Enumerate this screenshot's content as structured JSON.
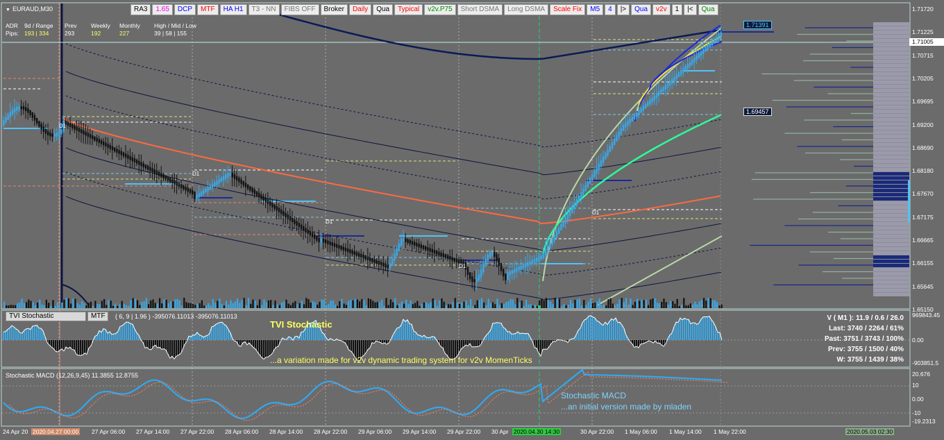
{
  "symbol": "EURAUD,M30",
  "toolbar": [
    {
      "label": "RA3",
      "color": "#000000"
    },
    {
      "label": "1.65",
      "color": "#ff00ff"
    },
    {
      "label": "DCP",
      "color": "#0000ff"
    },
    {
      "label": "MTF",
      "color": "#ff0000"
    },
    {
      "label": "HA H1",
      "color": "#0000ff"
    },
    {
      "label": "T3 - NN",
      "color": "#777777"
    },
    {
      "label": "FIBS OFF",
      "color": "#777777"
    },
    {
      "label": "Broker",
      "color": "#000000"
    },
    {
      "label": "Daily",
      "color": "#ff0000"
    },
    {
      "label": "Qua",
      "color": "#000000"
    },
    {
      "label": "Typical",
      "color": "#ff0000"
    },
    {
      "label": "v2v.P75",
      "color": "#008800"
    },
    {
      "label": "Short DSMA",
      "color": "#777777"
    },
    {
      "label": "Long DSMA",
      "color": "#777777"
    },
    {
      "label": "Scale Fix",
      "color": "#ff0000"
    },
    {
      "label": "M5",
      "color": "#0000ff"
    },
    {
      "label": "4",
      "color": "#0000ff"
    },
    {
      "label": "|>",
      "color": "#000000"
    },
    {
      "label": "Qua",
      "color": "#0000ff"
    },
    {
      "label": "v2v",
      "color": "#ff0000"
    },
    {
      "label": "1",
      "color": "#000000"
    },
    {
      "label": "|<",
      "color": "#000000"
    },
    {
      "label": "Qua",
      "color": "#008800"
    }
  ],
  "adr": {
    "h1": "ADR",
    "h2": "9d / Range",
    "h3": "Prev",
    "h4": "Weekly",
    "h5": "Monthly",
    "h6": "High / Mid / Low",
    "r1": "Pips:",
    "r2": "193 | 334",
    "r3": "293",
    "r4": "192",
    "r5": "227",
    "r6": "39 | 58 | 155"
  },
  "price_axis": [
    "1.71720",
    "1.71225",
    "1.70715",
    "1.70205",
    "1.69695",
    "1.69200",
    "1.68690",
    "1.68180",
    "1.67670",
    "1.67175",
    "1.66665",
    "1.66155",
    "1.65645",
    "1.65150"
  ],
  "current_price": "1.71005",
  "tags": {
    "upper": "1.71391",
    "lower": "1.69457"
  },
  "d1_label": "D1",
  "tvi": {
    "title": "TVI Stochastic",
    "mtf": "MTF",
    "params": "( 6, 9 | 1.96 ) -395076.11013 -395076.11013",
    "heading": "TVI Stochastic",
    "caption": "...a variation made for v2v dynamic trading system for v2v MomenTicks",
    "axis": [
      "969843.45",
      "0.00",
      "-903851.5"
    ],
    "info": [
      "V ( M1 ): 11.9 / 0.6 / 26.0",
      "Last: 3740 / 2264 / 61%",
      "Past: 3751 / 3743 / 100%",
      "Prev: 3755 / 1500 / 40%",
      "W: 3755 / 1439 / 38%"
    ]
  },
  "macd": {
    "title": "Stochastic MACD (12,26,9,45) 11.3855 12.8755",
    "heading": "Stochastic MACD",
    "caption": "...an initial version made by mladen",
    "axis": [
      "20.676",
      "10",
      "0.00",
      "-10",
      "-19.2313"
    ]
  },
  "time_axis": [
    {
      "label": "24 Apr 20",
      "style": ""
    },
    {
      "label": "2020.04.27 00:00",
      "style": "hl2"
    },
    {
      "label": "27 Apr 06:00",
      "style": ""
    },
    {
      "label": "27 Apr 14:00",
      "style": ""
    },
    {
      "label": "27 Apr 22:00",
      "style": ""
    },
    {
      "label": "28 Apr 06:00",
      "style": ""
    },
    {
      "label": "28 Apr 14:00",
      "style": ""
    },
    {
      "label": "28 Apr 22:00",
      "style": ""
    },
    {
      "label": "29 Apr 06:00",
      "style": ""
    },
    {
      "label": "29 Apr 14:00",
      "style": ""
    },
    {
      "label": "29 Apr 22:00",
      "style": ""
    },
    {
      "label": "30 Apr",
      "style": ""
    },
    {
      "label": "2020.04.30 14:30",
      "style": "hl"
    },
    {
      "label": "30 Apr 22:00",
      "style": ""
    },
    {
      "label": "1 May 06:00",
      "style": ""
    },
    {
      "label": "1 May 14:00",
      "style": ""
    },
    {
      "label": "1 May 22:00",
      "style": ""
    },
    {
      "label": "2020.05.03 02:30",
      "style": "hl3"
    }
  ]
}
